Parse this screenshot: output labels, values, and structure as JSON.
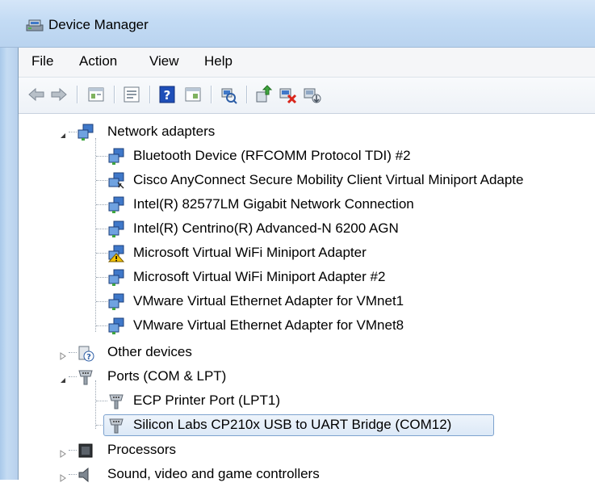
{
  "window": {
    "title": "Device Manager"
  },
  "menu": [
    {
      "label": "File"
    },
    {
      "label": "Action"
    },
    {
      "label": "View"
    },
    {
      "label": "Help"
    }
  ],
  "toolbar": {
    "buttons": [
      "back-arrow-icon",
      "forward-arrow-icon",
      "properties-grid-icon",
      "show-hide-console-tree-icon",
      "help-icon",
      "view-pane-icon",
      "scan-hardware-icon",
      "update-driver-icon",
      "uninstall-device-icon",
      "disable-device-icon"
    ]
  },
  "tree": {
    "network_adapters": {
      "label": "Network adapters",
      "children": [
        "Bluetooth Device (RFCOMM Protocol TDI) #2",
        "Cisco AnyConnect Secure Mobility Client Virtual Miniport Adapte",
        "Intel(R) 82577LM Gigabit Network Connection",
        "Intel(R) Centrino(R) Advanced-N 6200 AGN",
        "Microsoft Virtual WiFi Miniport Adapter",
        "Microsoft Virtual WiFi Miniport Adapter #2",
        "VMware Virtual Ethernet Adapter for VMnet1",
        "VMware Virtual Ethernet Adapter for VMnet8"
      ]
    },
    "other_devices": {
      "label": "Other devices"
    },
    "ports": {
      "label": "Ports (COM & LPT)",
      "children": [
        "ECP Printer Port (LPT1)",
        "Silicon Labs CP210x USB to UART Bridge (COM12)"
      ]
    },
    "processors": {
      "label": "Processors"
    },
    "sound": {
      "label": "Sound, video and game controllers"
    }
  },
  "colors": {
    "accent": "#7da2ce",
    "warning": "#f2c200",
    "error": "#d9261c"
  }
}
